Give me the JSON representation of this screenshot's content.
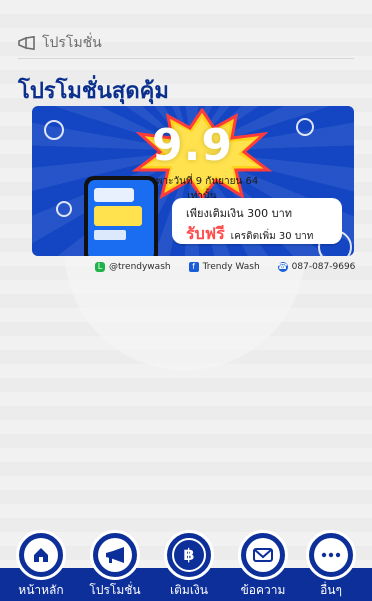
{
  "header": {
    "title": "โปรโมชั่น"
  },
  "main": {
    "section_title": "โปรโมชั่นสุดคุ้ม",
    "banner": {
      "big_text": "9.9",
      "small_text": "เฉพาะวันที่ 9 กันยายน 64 เท่านั้น",
      "promo_line1": "เพียงเติมเงิน 300 บาท",
      "promo_line2_highlight": "รับฟรี",
      "promo_line2_rest": "เครดิตเพิ่ม 30 บาท",
      "contacts": [
        {
          "icon": "line-icon",
          "label": "@trendywash"
        },
        {
          "icon": "facebook-icon",
          "label": "Trendy Wash"
        },
        {
          "icon": "phone-icon",
          "label": "087-087-9696"
        }
      ]
    }
  },
  "bottom_nav": {
    "items": [
      {
        "label": "หน้าหลัก",
        "icon": "home-icon"
      },
      {
        "label": "โปรโมชั่น",
        "icon": "megaphone-icon"
      },
      {
        "label": "เติมเงิน",
        "icon": "baht-coin-icon"
      },
      {
        "label": "ข้อความ",
        "icon": "mail-icon"
      },
      {
        "label": "อื่นๆ",
        "icon": "more-icon"
      }
    ]
  },
  "colors": {
    "primary": "#0d2f9a",
    "banner": "#1446c4",
    "highlight": "#ff4b4b"
  }
}
